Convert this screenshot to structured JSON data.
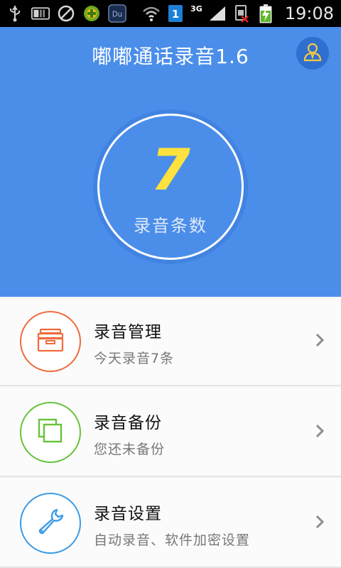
{
  "status_bar": {
    "time": "19:08",
    "network": "3G",
    "sim_label": "1",
    "notification_icons": [
      "usb-icon",
      "sd-card-icon",
      "blocked-icon",
      "game-icon",
      "du-app-icon"
    ],
    "system_icons": [
      "wifi-icon",
      "sim-1-icon",
      "signal-icon",
      "sim-missing-icon",
      "battery-charging-icon"
    ]
  },
  "header": {
    "title": "嘟嘟通话录音1.6",
    "profile_icon": "user-profile-icon"
  },
  "summary": {
    "count": "7",
    "label": "录音条数"
  },
  "menu": {
    "items": [
      {
        "title": "录音管理",
        "subtitle": "今天录音7条",
        "icon": "archive-box-icon",
        "color": "#f06a3c"
      },
      {
        "title": "录音备份",
        "subtitle": "您还未备份",
        "icon": "copy-layers-icon",
        "color": "#67c23a"
      },
      {
        "title": "录音设置",
        "subtitle": "自动录音、软件加密设置",
        "icon": "wrench-icon",
        "color": "#3a9be6"
      }
    ]
  },
  "colors": {
    "hero_bg": "#4b8eea",
    "count_color": "#ffe23d",
    "status_bar_bg": "#000000"
  }
}
